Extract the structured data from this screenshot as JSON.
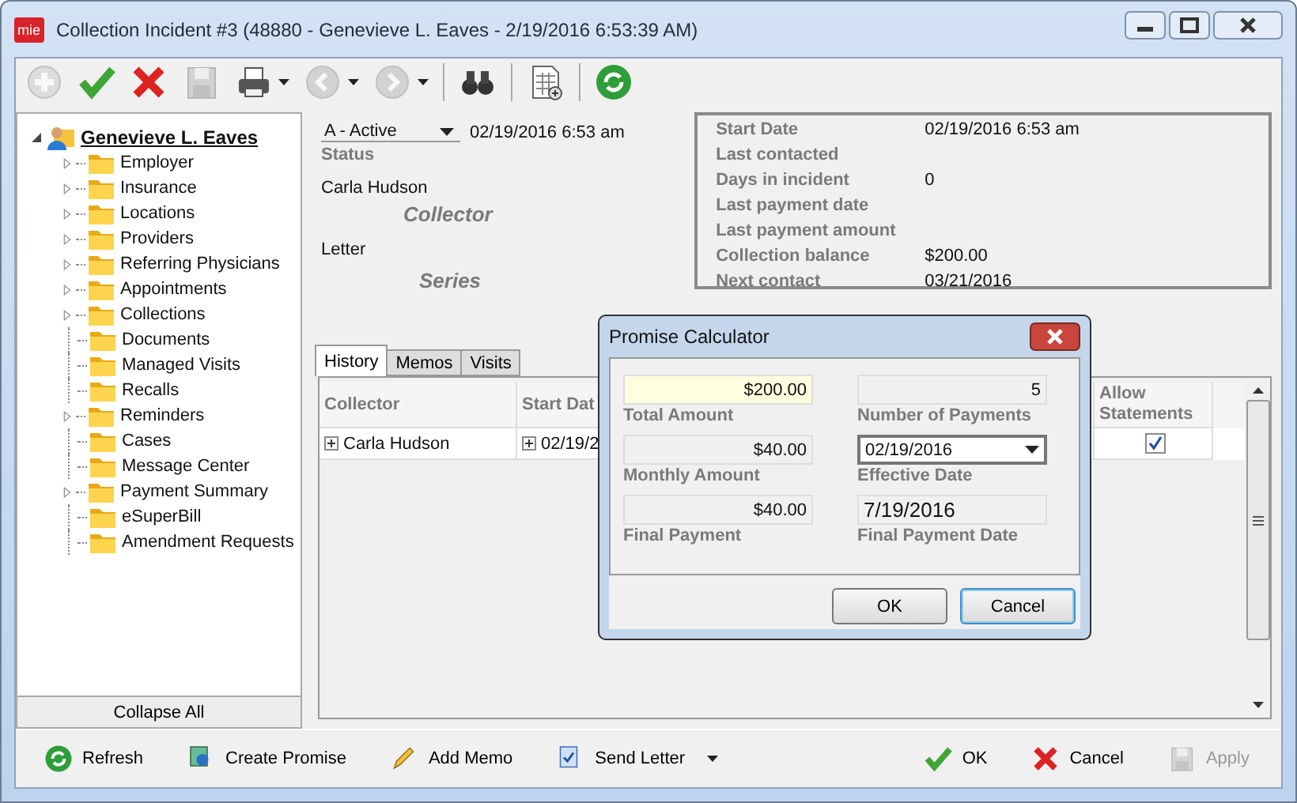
{
  "window": {
    "title": "Collection Incident #3 (48880 - Genevieve L. Eaves - 2/19/2016 6:53:39 AM)",
    "app_icon": "mie"
  },
  "toolbar": [
    {
      "kind": "add",
      "disabled": true,
      "dropdown": false
    },
    {
      "kind": "accept",
      "disabled": false,
      "dropdown": false
    },
    {
      "kind": "delete",
      "disabled": false,
      "dropdown": false
    },
    {
      "kind": "save",
      "disabled": true,
      "dropdown": false
    },
    {
      "kind": "print",
      "disabled": false,
      "dropdown": true
    },
    {
      "kind": "back",
      "disabled": true,
      "dropdown": true
    },
    {
      "kind": "forward",
      "disabled": true,
      "dropdown": true
    },
    {
      "kind": "separator"
    },
    {
      "kind": "find",
      "disabled": false,
      "dropdown": false
    },
    {
      "kind": "separator"
    },
    {
      "kind": "calculator",
      "disabled": false,
      "dropdown": false
    },
    {
      "kind": "separator"
    },
    {
      "kind": "refresh",
      "disabled": false,
      "dropdown": false
    }
  ],
  "tree": {
    "root": {
      "label": "Genevieve L. Eaves",
      "expanded": true,
      "children": [
        {
          "label": "Employer",
          "expandable": true
        },
        {
          "label": "Insurance",
          "expandable": true
        },
        {
          "label": "Locations",
          "expandable": true
        },
        {
          "label": "Providers",
          "expandable": true
        },
        {
          "label": "Referring Physicians",
          "expandable": true
        },
        {
          "label": "Appointments",
          "expandable": true
        },
        {
          "label": "Collections",
          "expandable": true
        },
        {
          "label": "Documents",
          "expandable": false
        },
        {
          "label": "Managed Visits",
          "expandable": false
        },
        {
          "label": "Recalls",
          "expandable": false
        },
        {
          "label": "Reminders",
          "expandable": true
        },
        {
          "label": "Cases",
          "expandable": false
        },
        {
          "label": "Message Center",
          "expandable": false
        },
        {
          "label": "Payment Summary",
          "expandable": true
        },
        {
          "label": "eSuperBill",
          "expandable": false
        },
        {
          "label": "Amendment Requests",
          "expandable": false
        }
      ]
    },
    "collapse_button": "Collapse All"
  },
  "status": {
    "value": "A - Active",
    "date": "02/19/2016 6:53 am",
    "label": "Status"
  },
  "collector": {
    "value": "Carla Hudson",
    "label": "Collector"
  },
  "letter": {
    "value": "Letter",
    "label": "Series"
  },
  "summary": [
    {
      "label": "Start Date",
      "value": "02/19/2016 6:53 am"
    },
    {
      "label": "Last contacted"
    },
    {
      "label": "Days in incident",
      "value": "0"
    },
    {
      "label": "Last payment date"
    },
    {
      "label": "Last payment amount"
    },
    {
      "label": "Collection balance",
      "value": "$200.00"
    },
    {
      "label": "Next contact",
      "value": "03/21/2016"
    }
  ],
  "tabs": [
    {
      "label": "History",
      "selected": true
    },
    {
      "label": "Memos",
      "selected": false
    },
    {
      "label": "Visits",
      "selected": false
    }
  ],
  "history_table": {
    "columns": [
      "Collector",
      "Start Dat",
      "Allow Statements"
    ],
    "rows": [
      {
        "collector": "Carla Hudson",
        "start_date": "02/19/2",
        "allow_statements": true
      }
    ]
  },
  "dialog": {
    "title": "Promise Calculator",
    "fields": [
      {
        "label": "Total Amount",
        "value": "$200.00",
        "kind": "amount",
        "highlighted": true
      },
      {
        "label": "Number of Payments",
        "value": "5",
        "kind": "amount",
        "highlighted": false
      },
      {
        "label": "Monthly Amount",
        "value": "$40.00",
        "kind": "amount",
        "highlighted": false
      },
      {
        "label": "Effective Date",
        "value": "02/19/2016",
        "kind": "date-picker",
        "highlighted": false
      },
      {
        "label": "Final Payment",
        "value": "$40.00",
        "kind": "amount",
        "highlighted": false
      },
      {
        "label": "Final Payment Date",
        "value": "7/19/2016",
        "kind": "date",
        "highlighted": false
      }
    ],
    "buttons": [
      {
        "label": "OK",
        "focused": false
      },
      {
        "label": "Cancel",
        "focused": true
      }
    ]
  },
  "actions_left": [
    {
      "label": "Refresh",
      "kind": "refresh",
      "dropdown": false
    },
    {
      "label": "Create Promise",
      "kind": "promise",
      "dropdown": false
    },
    {
      "label": "Add Memo",
      "kind": "memo",
      "dropdown": false
    },
    {
      "label": "Send Letter",
      "kind": "letter",
      "dropdown": true
    }
  ],
  "actions_right": [
    {
      "label": "OK",
      "kind": "ok",
      "disabled": false
    },
    {
      "label": "Cancel",
      "kind": "cancel",
      "disabled": false
    },
    {
      "label": "Apply",
      "kind": "apply",
      "disabled": true
    }
  ]
}
